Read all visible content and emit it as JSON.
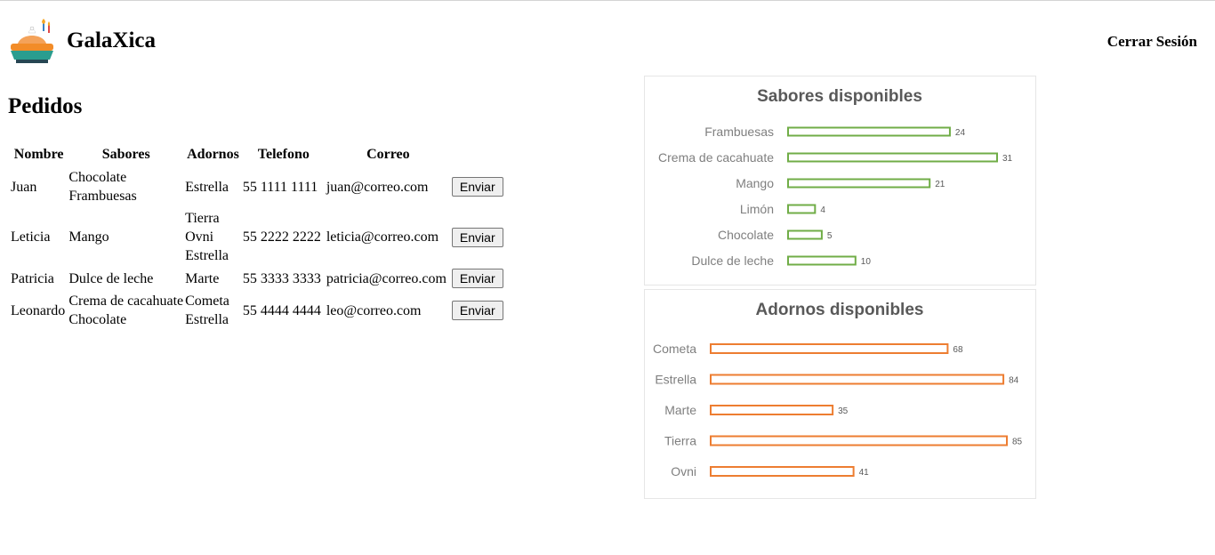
{
  "header": {
    "brand": "GalaXica",
    "logout_label": "Cerrar Sesión"
  },
  "main": {
    "title": "Pedidos",
    "columns": [
      "Nombre",
      "Sabores",
      "Adornos",
      "Telefono",
      "Correo"
    ],
    "rows": [
      {
        "name": "Juan",
        "sabores": [
          "Chocolate",
          "Frambuesas"
        ],
        "adornos": [
          "Estrella"
        ],
        "phone": "55 1111 1111",
        "email": "juan@correo.com",
        "action": "Enviar"
      },
      {
        "name": "Leticia",
        "sabores": [
          "Mango"
        ],
        "adornos": [
          "Tierra",
          "Ovni",
          "Estrella"
        ],
        "phone": "55 2222 2222",
        "email": "leticia@correo.com",
        "action": "Enviar"
      },
      {
        "name": "Patricia",
        "sabores": [
          "Dulce de leche"
        ],
        "adornos": [
          "Marte"
        ],
        "phone": "55 3333 3333",
        "email": "patricia@correo.com",
        "action": "Enviar"
      },
      {
        "name": "Leonardo",
        "sabores": [
          "Crema de cacahuate",
          "Chocolate"
        ],
        "adornos": [
          "Cometa",
          "Estrella"
        ],
        "phone": "55 4444 4444",
        "email": "leo@correo.com",
        "action": "Enviar"
      }
    ]
  },
  "chart_data": [
    {
      "type": "bar",
      "orientation": "horizontal",
      "title": "Sabores disponibles",
      "categories": [
        "Frambuesas",
        "Crema de cacahuate",
        "Mango",
        "Limón",
        "Chocolate",
        "Dulce de leche"
      ],
      "values": [
        24,
        31,
        21,
        4,
        5,
        10
      ],
      "color": "#70ad47",
      "xlim": [
        0,
        31
      ]
    },
    {
      "type": "bar",
      "orientation": "horizontal",
      "title": "Adornos disponibles",
      "categories": [
        "Cometa",
        "Estrella",
        "Marte",
        "Tierra",
        "Ovni"
      ],
      "values": [
        68,
        84,
        35,
        85,
        41
      ],
      "color": "#ed7d31",
      "xlim": [
        0,
        85
      ]
    }
  ]
}
